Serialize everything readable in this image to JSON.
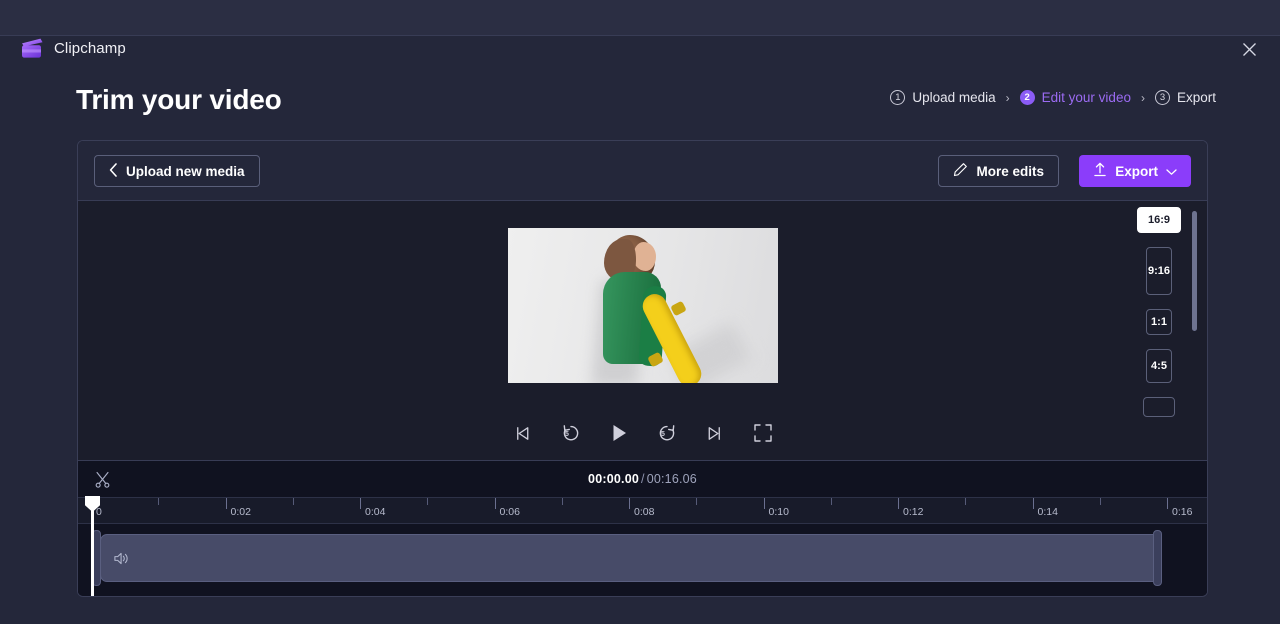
{
  "app": {
    "name": "Clipchamp",
    "logo_icon": "clapperboard-icon",
    "close_icon": "close-icon",
    "accent_color": "#8b3dfa",
    "background_color": "#24273a"
  },
  "page": {
    "title": "Trim your video"
  },
  "breadcrumb": {
    "separator": "›",
    "steps": [
      {
        "number": "1",
        "label": "Upload media",
        "active": false
      },
      {
        "number": "2",
        "label": "Edit your video",
        "active": true
      },
      {
        "number": "3",
        "label": "Export",
        "active": false
      }
    ]
  },
  "toolbar": {
    "upload_new_media": {
      "label": "Upload new media",
      "icon": "chevron-left-icon"
    },
    "more_edits": {
      "label": "More edits",
      "icon": "pencil-icon"
    },
    "export": {
      "label": "Export",
      "icon": "upload-arrow-icon",
      "caret": "chevron-down-icon"
    }
  },
  "preview": {
    "alt": "woman in green sweater holding yellow skateboard",
    "controls": [
      {
        "name": "skip-to-start-button",
        "icon": "skip-previous-icon",
        "label": ""
      },
      {
        "name": "rewind-5-button",
        "icon": "rewind-icon",
        "label": "5"
      },
      {
        "name": "play-button",
        "icon": "play-icon",
        "label": ""
      },
      {
        "name": "forward-5-button",
        "icon": "forward-icon",
        "label": "5"
      },
      {
        "name": "skip-to-end-button",
        "icon": "skip-next-icon",
        "label": ""
      },
      {
        "name": "fullscreen-button",
        "icon": "fullscreen-icon",
        "label": ""
      }
    ]
  },
  "aspect_ratios": {
    "selected": "16:9",
    "options": [
      {
        "label": "16:9",
        "selected": true
      },
      {
        "label": "9:16",
        "selected": false
      },
      {
        "label": "1:1",
        "selected": false
      },
      {
        "label": "4:5",
        "selected": false
      },
      {
        "label": "",
        "selected": false
      }
    ]
  },
  "timeline": {
    "split_icon": "scissors-icon",
    "current_time": "00:00.00",
    "separator": "/",
    "total_time": "00:16.06",
    "ruler_labels": [
      "0",
      "0:02",
      "0:04",
      "0:06",
      "0:08",
      "0:10",
      "0:12",
      "0:14",
      "0:16"
    ],
    "clip": {
      "audio_icon": "speaker-icon"
    },
    "playhead_position": "0"
  }
}
